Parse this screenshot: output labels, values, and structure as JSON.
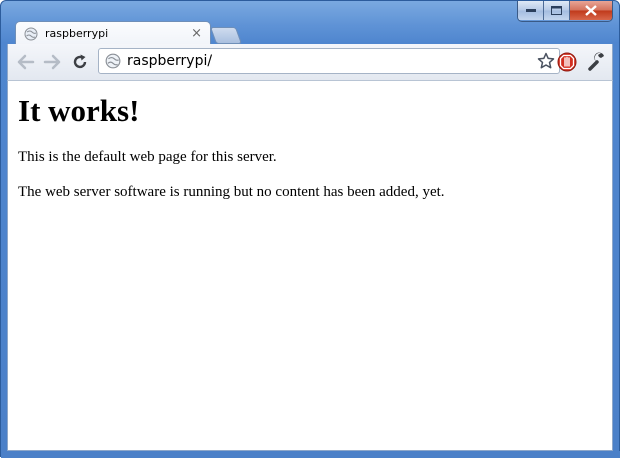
{
  "tab": {
    "title": "raspberrypi",
    "favicon": "globe-icon",
    "close_symbol": "×"
  },
  "window_controls": [
    "minimize-icon",
    "maximize-icon",
    "close-icon"
  ],
  "omnibox": {
    "url": "raspberrypi/",
    "page_icon": "globe-icon"
  },
  "toolbar": {
    "back": "back-arrow-icon",
    "forward": "forward-arrow-icon",
    "reload": "reload-icon",
    "bookmark": "star-icon",
    "extension": "stop-icon",
    "menu": "wrench-icon"
  },
  "page": {
    "heading": "It works!",
    "paragraphs": [
      "This is the default web page for this server.",
      "The web server software is running but no content has been added, yet."
    ]
  },
  "colors": {
    "frame": "#5f93d6",
    "extension_red": "#d32f20"
  }
}
